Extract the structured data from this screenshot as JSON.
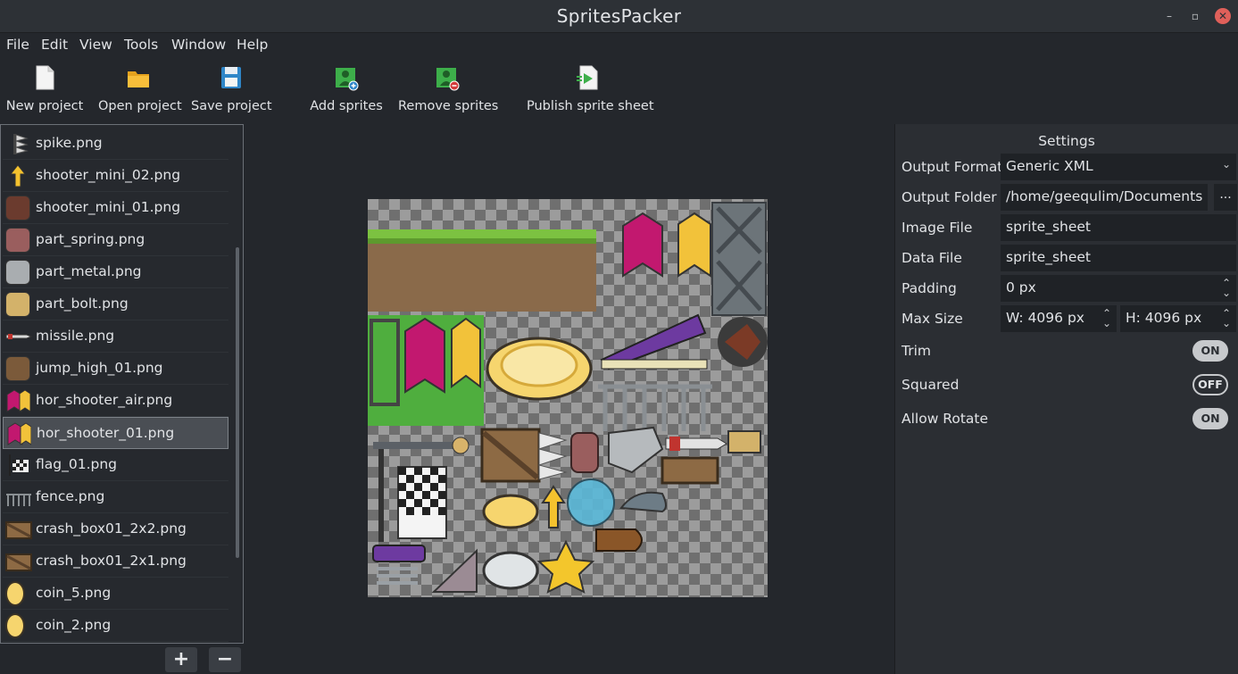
{
  "window": {
    "title": "SpritesPacker"
  },
  "menu": [
    "File",
    "Edit",
    "View",
    "Tools",
    "Window",
    "Help"
  ],
  "toolbar": {
    "new_project": "New project",
    "open_project": "Open project",
    "save_project": "Save project",
    "add_sprites": "Add sprites",
    "remove_sprites": "Remove sprites",
    "publish": "Publish sprite sheet"
  },
  "sprites": [
    {
      "name": "spike.png",
      "icon": "spike-icon",
      "selected": false
    },
    {
      "name": "shooter_mini_02.png",
      "icon": "arrow-up-icon",
      "selected": false
    },
    {
      "name": "shooter_mini_01.png",
      "icon": "ball-icon",
      "selected": false
    },
    {
      "name": "part_spring.png",
      "icon": "spring-icon",
      "selected": false
    },
    {
      "name": "part_metal.png",
      "icon": "metal-part-icon",
      "selected": false
    },
    {
      "name": "part_bolt.png",
      "icon": "bolt-icon",
      "selected": false
    },
    {
      "name": "missile.png",
      "icon": "missile-icon",
      "selected": false
    },
    {
      "name": "jump_high_01.png",
      "icon": "jump-icon",
      "selected": false
    },
    {
      "name": "hor_shooter_air.png",
      "icon": "shooter-icon",
      "selected": false
    },
    {
      "name": "hor_shooter_01.png",
      "icon": "shooter-icon",
      "selected": true
    },
    {
      "name": "flag_01.png",
      "icon": "flag-icon",
      "selected": false
    },
    {
      "name": "fence.png",
      "icon": "fence-icon",
      "selected": false
    },
    {
      "name": "crash_box01_2x2.png",
      "icon": "crate-icon",
      "selected": false
    },
    {
      "name": "crash_box01_2x1.png",
      "icon": "crate-icon",
      "selected": false
    },
    {
      "name": "coin_5.png",
      "icon": "coin-icon",
      "selected": false
    },
    {
      "name": "coin_2.png",
      "icon": "coin-icon",
      "selected": false
    }
  ],
  "list_buttons": {
    "add": "+",
    "remove": "−"
  },
  "settings": {
    "heading": "Settings",
    "output_format": {
      "label": "Output Format",
      "value": "Generic XML"
    },
    "output_folder": {
      "label": "Output Folder",
      "value": "/home/geequlim/Documents",
      "browse": "..."
    },
    "image_file": {
      "label": "Image File",
      "value": "sprite_sheet"
    },
    "data_file": {
      "label": "Data File",
      "value": "sprite_sheet"
    },
    "padding": {
      "label": "Padding",
      "value": "0 px"
    },
    "max_size": {
      "label": "Max Size",
      "width": "W: 4096 px",
      "height": "H: 4096 px"
    },
    "trim": {
      "label": "Trim",
      "state": "ON"
    },
    "squared": {
      "label": "Squared",
      "state": "OFF"
    },
    "allow_rotate": {
      "label": "Allow Rotate",
      "state": "ON"
    }
  },
  "colors": {
    "accent_selected": "#4a4e54",
    "toggle_on": "#c7c9cc"
  }
}
